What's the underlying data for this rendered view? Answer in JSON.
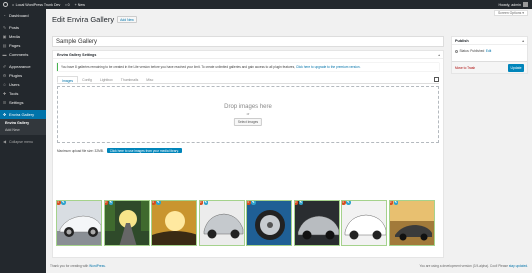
{
  "adminbar": {
    "site_name": "Local WordPress Trunk Dev",
    "comments_count": "0",
    "new_label": "New",
    "howdy": "Howdy, admin"
  },
  "sidebar": {
    "items": [
      {
        "label": "Dashboard",
        "icon": "dashboard-icon"
      },
      {
        "label": "Posts",
        "icon": "pin-icon"
      },
      {
        "label": "Media",
        "icon": "media-icon"
      },
      {
        "label": "Pages",
        "icon": "page-icon"
      },
      {
        "label": "Comments",
        "icon": "comment-icon"
      },
      {
        "label": "Appearance",
        "icon": "brush-icon"
      },
      {
        "label": "Plugins",
        "icon": "plugin-icon"
      },
      {
        "label": "Users",
        "icon": "user-icon"
      },
      {
        "label": "Tools",
        "icon": "wrench-icon"
      },
      {
        "label": "Settings",
        "icon": "settings-icon"
      }
    ],
    "active": {
      "label": "Envira Gallery",
      "icon": "gallery-icon"
    },
    "submenu": [
      "Envira Gallery",
      "Add New"
    ],
    "collapse_label": "Collapse menu"
  },
  "header": {
    "screen_options": "Screen Options ▾",
    "title": "Edit Envira Gallery",
    "add_new": "Add New"
  },
  "gallery_title": "Sample Gallery",
  "settings_box": {
    "title": "Envira Gallery Settings",
    "toggle": "▴",
    "notice_text": "You have 8 galleries remaining to be created in the Lite version before you have reached your limit. To create unlimited galleries and gain access to all plugin features,",
    "notice_link": "Click here to upgrade to the premium version.",
    "tabs": [
      "Images",
      "Config",
      "Lightbox",
      "Thumbnails",
      "Misc"
    ],
    "active_tab": 0,
    "drop_text": "Drop images here",
    "drop_or": "or",
    "select_button": "Select Images",
    "upload_size": "Maximum upload file size: 32MB.",
    "media_button": "Click here to use images from your media library."
  },
  "gallery_images": [
    {
      "name": "white-sports-car-side"
    },
    {
      "name": "road-trees-sunset"
    },
    {
      "name": "car-hood-sunset"
    },
    {
      "name": "silver-car-front"
    },
    {
      "name": "blue-wheel-rim"
    },
    {
      "name": "silver-car-dark"
    },
    {
      "name": "white-car-front"
    },
    {
      "name": "car-road-sunset"
    }
  ],
  "publish_box": {
    "title": "Publish",
    "toggle": "▴",
    "status_text": "Status: Published",
    "edit_link": "Edit",
    "trash_link": "Move to Trash",
    "update_button": "Update"
  },
  "footer": {
    "left_prefix": "Thank you for creating with",
    "left_link": "WordPress.",
    "right_text": "You are using a development version (3.9-alpha). Cool! Please",
    "right_link": "stay updated."
  },
  "colors": {
    "adminbar": "#23282d",
    "active_menu": "#0073aa",
    "button_primary": "#0085ba",
    "thumb_border": "#a5d28c",
    "notice_border": "#46b450"
  }
}
